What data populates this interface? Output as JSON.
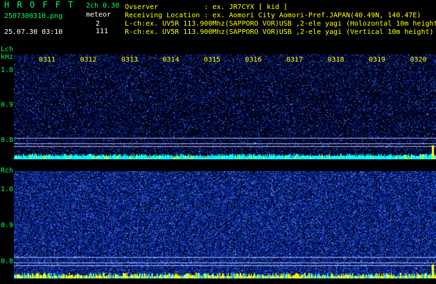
{
  "header": {
    "logo": "H R O F F T",
    "mode": "2ch 0.30",
    "filename": "2507300310.png",
    "type_label": "meteor",
    "datetime": "25.07.30 03:10",
    "count_l": "2",
    "count_r": "111",
    "observer_line": "Ovserver           : ex. JR7CYX [ kid ]",
    "location_line": "Receiving Location : ex. Aomori City Aomori-Pref.JAPAN(40.49N, 140.47E)",
    "lch_line": "L-ch:ex. UV5R 113.900Mhz(SAPPORO VOR)USB ,2-ele yagi (Holozontal 10m height)",
    "rch_line": "R-ch:ex. UV5R 113.900Mhz(SAPPORO VOR)USB ,2-ele yagi (Vertical 10m height)"
  },
  "lch": {
    "label": "Lch",
    "unit": "kHz",
    "y_ticks": [
      "1.0",
      "0.9",
      "0.8"
    ]
  },
  "rch": {
    "label": "Rch",
    "y_ticks": [
      "1.0",
      "0.9",
      "0.8"
    ]
  },
  "time_ticks": [
    "0311",
    "0312",
    "0313",
    "0314",
    "0315",
    "0316",
    "0317",
    "0318",
    "0319",
    "0320"
  ],
  "colors": {
    "background": "#000000",
    "label_green": "#00ff66",
    "text_yellow": "#ffff00",
    "noise_dark": "#001a66",
    "noise_mid": "#1f3fc0",
    "baseline_cyan": "#00ffff",
    "baseline_yellow": "#ffff00"
  }
}
